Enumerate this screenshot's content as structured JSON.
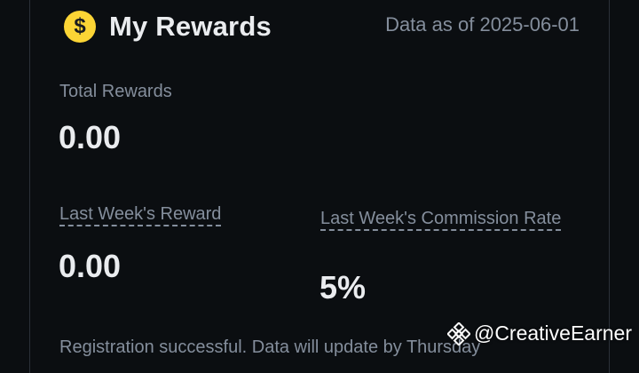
{
  "header": {
    "icon": "dollar-coin-icon",
    "coin_symbol": "$",
    "title": "My Rewards",
    "data_as_of": "Data as of 2025-06-01"
  },
  "total_rewards": {
    "label": "Total Rewards",
    "value": "0.00"
  },
  "last_week_reward": {
    "label": "Last Week's Reward",
    "value": "0.00"
  },
  "commission_rate": {
    "label": "Last Week's Commission Rate",
    "value": "5%"
  },
  "note": "Registration successful. Data will update by Thursday",
  "watermark": {
    "icon": "binance-logo-icon",
    "handle": "@CreativeEarner"
  },
  "colors": {
    "accent": "#fcd535",
    "background": "#0b0e11",
    "muted": "#848e9c",
    "text": "#eaecef"
  }
}
